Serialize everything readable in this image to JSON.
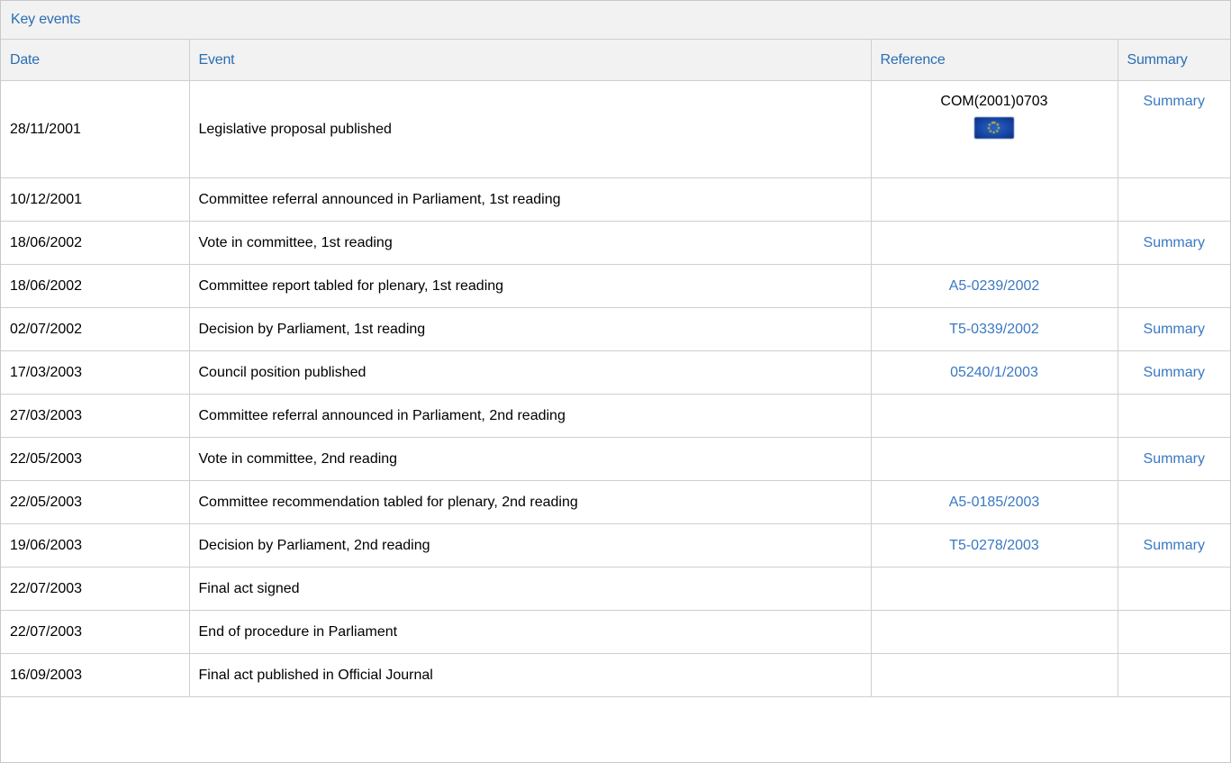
{
  "header": {
    "title": "Key events"
  },
  "columns": {
    "date": "Date",
    "event": "Event",
    "reference": "Reference",
    "summary": "Summary"
  },
  "colors": {
    "link": "#3a78c3",
    "header_bg": "#f2f2f2",
    "border": "#cfcfcf"
  },
  "rows": [
    {
      "date": "28/11/2001",
      "event": "Legislative proposal published",
      "reference": "COM(2001)0703",
      "reference_is_link": false,
      "reference_icon": "eu-flag-icon",
      "summary": "Summary"
    },
    {
      "date": "10/12/2001",
      "event": "Committee referral announced in Parliament, 1st reading",
      "reference": "",
      "summary": ""
    },
    {
      "date": "18/06/2002",
      "event": "Vote in committee, 1st reading",
      "reference": "",
      "summary": "Summary"
    },
    {
      "date": "18/06/2002",
      "event": "Committee report tabled for plenary, 1st reading",
      "reference": "A5-0239/2002",
      "summary": ""
    },
    {
      "date": "02/07/2002",
      "event": "Decision by Parliament, 1st reading",
      "reference": "T5-0339/2002",
      "summary": "Summary"
    },
    {
      "date": "17/03/2003",
      "event": "Council position published",
      "reference": "05240/1/2003",
      "summary": "Summary"
    },
    {
      "date": "27/03/2003",
      "event": "Committee referral announced in Parliament, 2nd reading",
      "reference": "",
      "summary": ""
    },
    {
      "date": "22/05/2003",
      "event": "Vote in committee, 2nd reading",
      "reference": "",
      "summary": "Summary"
    },
    {
      "date": "22/05/2003",
      "event": "Committee recommendation tabled for plenary, 2nd reading",
      "reference": "A5-0185/2003",
      "summary": ""
    },
    {
      "date": "19/06/2003",
      "event": "Decision by Parliament, 2nd reading",
      "reference": "T5-0278/2003",
      "summary": "Summary"
    },
    {
      "date": "22/07/2003",
      "event": "Final act signed",
      "reference": "",
      "summary": ""
    },
    {
      "date": "22/07/2003",
      "event": "End of procedure in Parliament",
      "reference": "",
      "summary": ""
    },
    {
      "date": "16/09/2003",
      "event": "Final act published in Official Journal",
      "reference": "",
      "summary": ""
    }
  ]
}
